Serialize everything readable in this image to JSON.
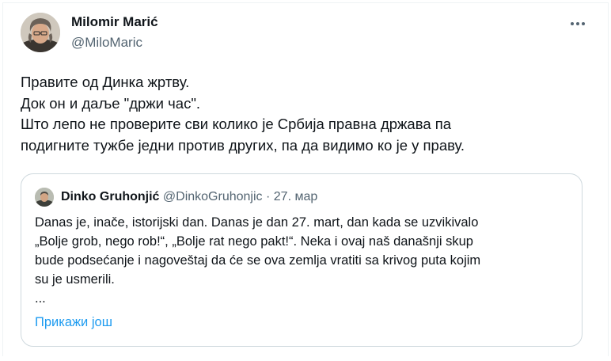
{
  "author": {
    "name": "Milomir Marić",
    "handle": "@MiloMaric"
  },
  "tweet": {
    "lines": [
      "Правите од Динка жртву.",
      "Док он и даље \"држи час\".",
      "Што лепо не проверите сви колико је Србија правна држава па",
      "подигните тужбе једни против других, па да видимо ко је у праву."
    ]
  },
  "quoted": {
    "name": "Dinko Gruhonjić",
    "handle": "@DinkoGruhonjic",
    "separator": "·",
    "date": "27. мар",
    "lines": [
      "Danas je, inače, istorijski dan. Danas je dan 27. mart, dan kada se uzvikivalo",
      "„Bolje grob, nego rob!“, „Bolje rat nego pakt!“. Neka i ovaj naš današnji skup",
      "bude podsećanje i nagoveštaj da će se ova zemlja vratiti sa krivog puta kojim",
      "su je usmerili.",
      "..."
    ],
    "show_more": "Прикажи још"
  },
  "icons": {
    "more": "more-horizontal-icon"
  }
}
